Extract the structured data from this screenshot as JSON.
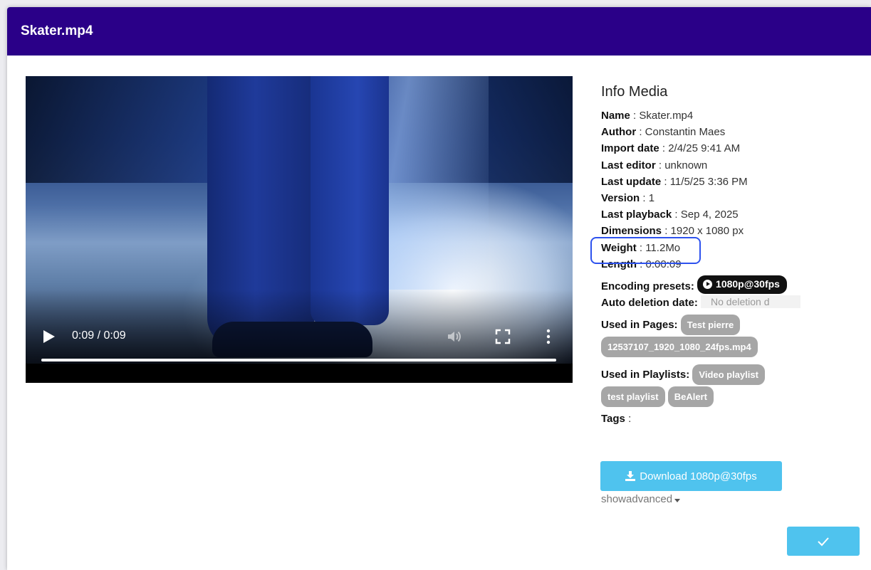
{
  "modal": {
    "title": "Skater.mp4"
  },
  "player": {
    "time_display": "0:09 / 0:09",
    "progress": 1.0,
    "icons": [
      "play-icon",
      "volume-icon",
      "fullscreen-icon",
      "more-vert-icon"
    ]
  },
  "info": {
    "title": "Info Media",
    "name": {
      "label": "Name",
      "value": "Skater.mp4"
    },
    "author": {
      "label": "Author",
      "value": "Constantin Maes"
    },
    "import_date": {
      "label": "Import date",
      "value": "2/4/25 9:41 AM"
    },
    "last_editor": {
      "label": "Last editor",
      "value": "unknown"
    },
    "last_update": {
      "label": "Last update",
      "value": "11/5/25 3:36 PM"
    },
    "version": {
      "label": "Version",
      "value": "1"
    },
    "last_playback": {
      "label": "Last playback",
      "value": "Sep 4, 2025"
    },
    "dimensions": {
      "label": "Dimensions",
      "value": "1920 x 1080 px"
    },
    "weight": {
      "label": "Weight",
      "value": "11.2Mo"
    },
    "length": {
      "label": "Length",
      "value": "0:00:09"
    },
    "encoding_presets": {
      "label": "Encoding presets:",
      "value": "1080p@30fps"
    },
    "auto_deletion": {
      "label": "Auto deletion date:",
      "value": "No deletion d"
    },
    "used_in_pages": {
      "label": "Used in Pages:",
      "items": [
        "Test pierre",
        "12537107_1920_1080_24fps.mp4"
      ]
    },
    "used_in_playlists": {
      "label": "Used in Playlists:",
      "items": [
        "Video playlist",
        "test playlist",
        "BeAlert"
      ]
    },
    "tags": {
      "label": "Tags",
      "value": ""
    }
  },
  "actions": {
    "download_label": "Download 1080p@30fps",
    "show_advanced": "showadvanced"
  },
  "colors": {
    "header": "#2a0088",
    "accent": "#4fc3ee",
    "highlight": "#2d52ee",
    "pill_gray": "#a6a6a6"
  }
}
